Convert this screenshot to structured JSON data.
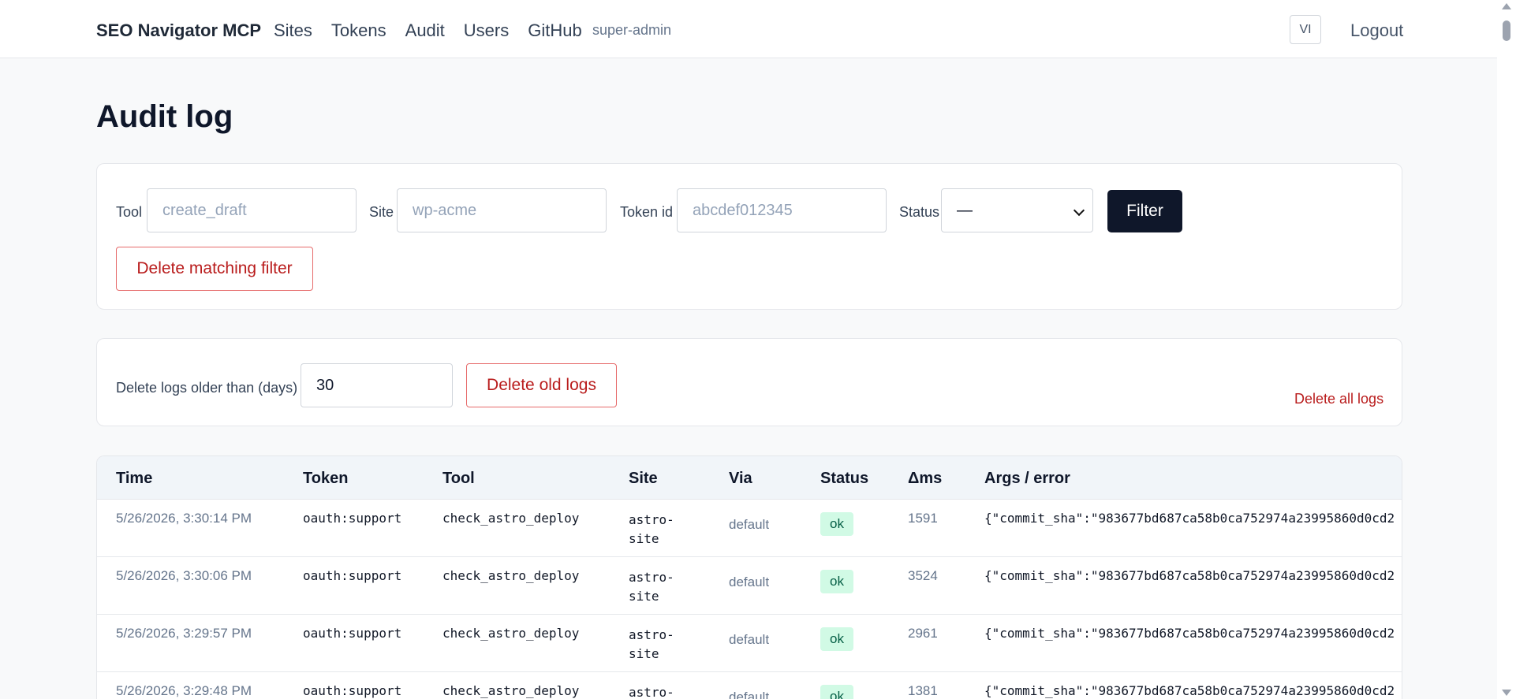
{
  "header": {
    "brand": "SEO Navigator MCP",
    "nav": [
      "Sites",
      "Tokens",
      "Audit",
      "Users",
      "GitHub"
    ],
    "role": "super-admin",
    "lang": "VI",
    "logout": "Logout"
  },
  "page": {
    "title": "Audit log"
  },
  "filter": {
    "tool_label": "Tool",
    "tool_placeholder": "create_draft",
    "site_label": "Site",
    "site_placeholder": "wp-acme",
    "token_label": "Token id",
    "token_placeholder": "abcdef012345",
    "status_label": "Status",
    "status_value": "—",
    "filter_button": "Filter",
    "delete_matching": "Delete matching filter"
  },
  "retention": {
    "label": "Delete logs older than (days)",
    "days": "30",
    "delete_old": "Delete old logs",
    "delete_all": "Delete all logs"
  },
  "table": {
    "columns": [
      "Time",
      "Token",
      "Tool",
      "Site",
      "Via",
      "Status",
      "Δms",
      "Args / error"
    ],
    "rows": [
      {
        "time": "5/26/2026, 3:30:14 PM",
        "token": "oauth:support",
        "tool": "check_astro_deploy",
        "site": "astro-site",
        "via": "default",
        "status": "ok",
        "ms": "1591",
        "args": "{\"commit_sha\":\"983677bd687ca58b0ca752974a23995860d0cd2"
      },
      {
        "time": "5/26/2026, 3:30:06 PM",
        "token": "oauth:support",
        "tool": "check_astro_deploy",
        "site": "astro-site",
        "via": "default",
        "status": "ok",
        "ms": "3524",
        "args": "{\"commit_sha\":\"983677bd687ca58b0ca752974a23995860d0cd2"
      },
      {
        "time": "5/26/2026, 3:29:57 PM",
        "token": "oauth:support",
        "tool": "check_astro_deploy",
        "site": "astro-site",
        "via": "default",
        "status": "ok",
        "ms": "2961",
        "args": "{\"commit_sha\":\"983677bd687ca58b0ca752974a23995860d0cd2"
      },
      {
        "time": "5/26/2026, 3:29:48 PM",
        "token": "oauth:support",
        "tool": "check_astro_deploy",
        "site": "astro-site",
        "via": "default",
        "status": "ok",
        "ms": "1381",
        "args": "{\"commit_sha\":\"983677bd687ca58b0ca752974a23995860d0cd2"
      }
    ]
  }
}
